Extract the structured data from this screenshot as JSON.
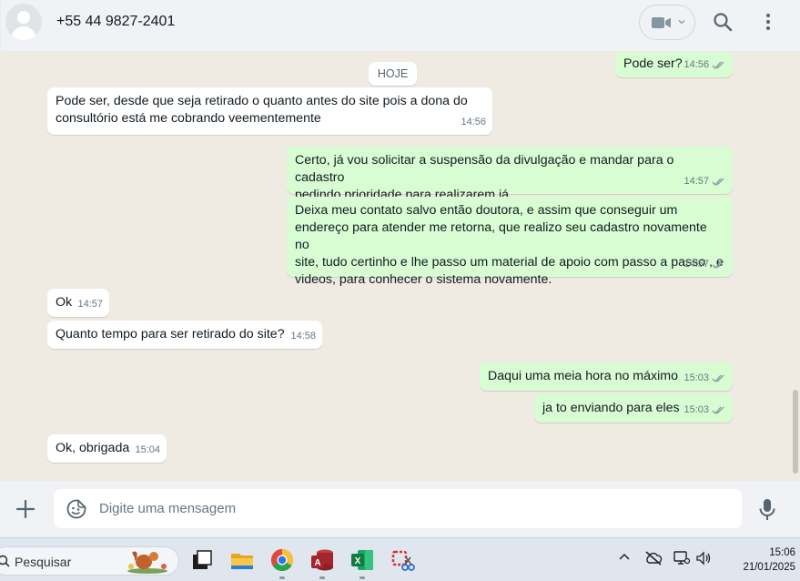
{
  "header": {
    "contact_name": "+55 44 9827-2401",
    "icons": [
      "avatar",
      "video-call-icon",
      "chevron-down-icon",
      "search-icon",
      "menu-icon"
    ]
  },
  "chat": {
    "day_chip": "HOJE",
    "messages": [
      {
        "dir": "out",
        "text": "Pode ser?",
        "time": "14:56",
        "status": "read"
      },
      {
        "dir": "in",
        "text": "Pode ser, desde que seja retirado o quanto antes do site pois a dona do\nconsultório está me cobrando veementemente",
        "time": "14:56"
      },
      {
        "dir": "out",
        "text": "Certo, já vou solicitar a suspensão da divulgação e mandar para o cadastro\npedindo prioridade para realizarem já .",
        "time": "14:57",
        "status": "read"
      },
      {
        "dir": "out",
        "text": "Deixa meu contato salvo então doutora, e assim que conseguir um\nendereço para atender me retorna, que realizo seu cadastro novamente no\nsite, tudo certinho e lhe passo um material de apoio com passo a passo , e\nvideos, para conhecer o sistema novamente.",
        "time": "14:57",
        "status": "read"
      },
      {
        "dir": "in",
        "text": "Ok",
        "time": "14:57"
      },
      {
        "dir": "in",
        "text": "Quanto tempo para ser retirado do site?",
        "time": "14:58"
      },
      {
        "dir": "out",
        "text": "Daqui uma meia hora no máximo",
        "time": "15:03",
        "status": "read"
      },
      {
        "dir": "out",
        "text": "ja to enviando para eles",
        "time": "15:03",
        "status": "read"
      },
      {
        "dir": "in",
        "text": "Ok, obrigada",
        "time": "15:04"
      }
    ]
  },
  "composer": {
    "placeholder": "Digite uma mensagem",
    "value": "",
    "icons": [
      "plus-icon",
      "sticker-icon",
      "microphone-icon"
    ]
  },
  "taskbar": {
    "search_label": "Pesquisar",
    "apps": [
      "task-view-icon",
      "file-explorer-icon",
      "chrome-icon",
      "access-icon",
      "excel-icon",
      "snipping-tool-icon"
    ],
    "tray": [
      "chevron-up-icon",
      "cloud-offline-icon",
      "network-icon",
      "volume-icon"
    ],
    "time": "15:06",
    "date": "21/01/2025"
  },
  "colors": {
    "chat_bg": "#efeae2",
    "incoming_bubble": "#ffffff",
    "outgoing_bubble": "#d9fdd3",
    "read_tick": "#8696a0",
    "header_bg": "#f0f2f5"
  }
}
